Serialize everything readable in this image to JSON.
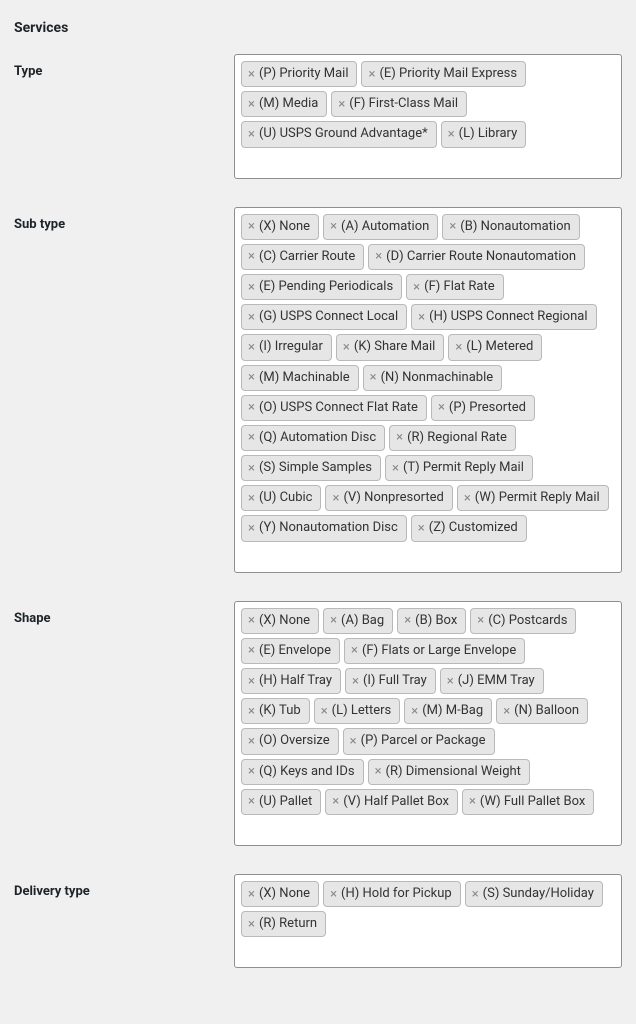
{
  "section_title": "Services",
  "fields": [
    {
      "label": "Type",
      "tags": [
        "(P) Priority Mail",
        "(E) Priority Mail Express",
        "(M) Media",
        "(F) First-Class Mail",
        "(U) USPS Ground Advantage*",
        "(L) Library"
      ]
    },
    {
      "label": "Sub type",
      "tags": [
        "(X) None",
        "(A) Automation",
        "(B) Nonautomation",
        "(C) Carrier Route",
        "(D) Carrier Route Nonautomation",
        "(E) Pending Periodicals",
        "(F) Flat Rate",
        "(G) USPS Connect Local",
        "(H) USPS Connect Regional",
        "(I) Irregular",
        "(K) Share Mail",
        "(L) Metered",
        "(M) Machinable",
        "(N) Nonmachinable",
        "(O) USPS Connect Flat Rate",
        "(P) Presorted",
        "(Q) Automation Disc",
        "(R) Regional Rate",
        "(S) Simple Samples",
        "(T) Permit Reply Mail",
        "(U) Cubic",
        "(V) Nonpresorted",
        "(W) Permit Reply Mail",
        "(Y) Nonautomation Disc",
        "(Z) Customized"
      ]
    },
    {
      "label": "Shape",
      "tags": [
        "(X) None",
        "(A) Bag",
        "(B) Box",
        "(C) Postcards",
        "(E) Envelope",
        "(F) Flats or Large Envelope",
        "(H) Half Tray",
        "(I) Full Tray",
        "(J) EMM Tray",
        "(K) Tub",
        "(L) Letters",
        "(M) M-Bag",
        "(N) Balloon",
        "(O) Oversize",
        "(P) Parcel or Package",
        "(Q) Keys and IDs",
        "(R) Dimensional Weight",
        "(U) Pallet",
        "(V) Half Pallet Box",
        "(W) Full Pallet Box"
      ]
    },
    {
      "label": "Delivery type",
      "tags": [
        "(X) None",
        "(H) Hold for Pickup",
        "(S) Sunday/Holiday",
        "(R) Return"
      ]
    }
  ]
}
